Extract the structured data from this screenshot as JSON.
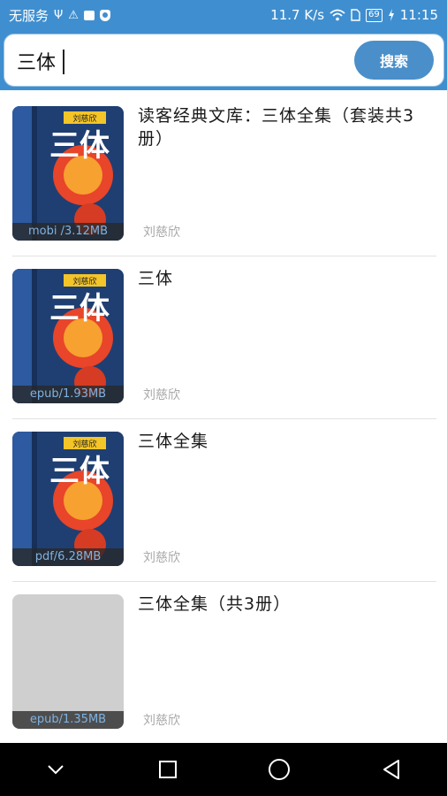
{
  "status_bar": {
    "carrier": "无服务",
    "speed": "11.7 K/s",
    "battery": "69",
    "time": "11:15"
  },
  "search": {
    "query": "三体",
    "button_label": "搜索"
  },
  "results": [
    {
      "title": "读客经典文库：三体全集（套装共3册）",
      "author": "刘慈欣",
      "format_size": "mobi /3.12MB",
      "has_cover": true
    },
    {
      "title": "三体",
      "author": "刘慈欣",
      "format_size": "epub/1.93MB",
      "has_cover": true
    },
    {
      "title": "三体全集",
      "author": "刘慈欣",
      "format_size": "pdf/6.28MB",
      "has_cover": true
    },
    {
      "title": "三体全集（共3册）",
      "author": "刘慈欣",
      "format_size": "epub/1.35MB",
      "has_cover": false
    }
  ],
  "cover_art": {
    "cover_text": "三体",
    "author_badge": "刘慈欣"
  },
  "nav": {
    "icons": [
      "chevron-down-icon",
      "recent-apps-icon",
      "home-icon",
      "back-icon"
    ]
  },
  "colors": {
    "header_blue": "#3f8fd0",
    "button_blue": "#4a8fc9",
    "label_blue": "#7fb2e2"
  }
}
